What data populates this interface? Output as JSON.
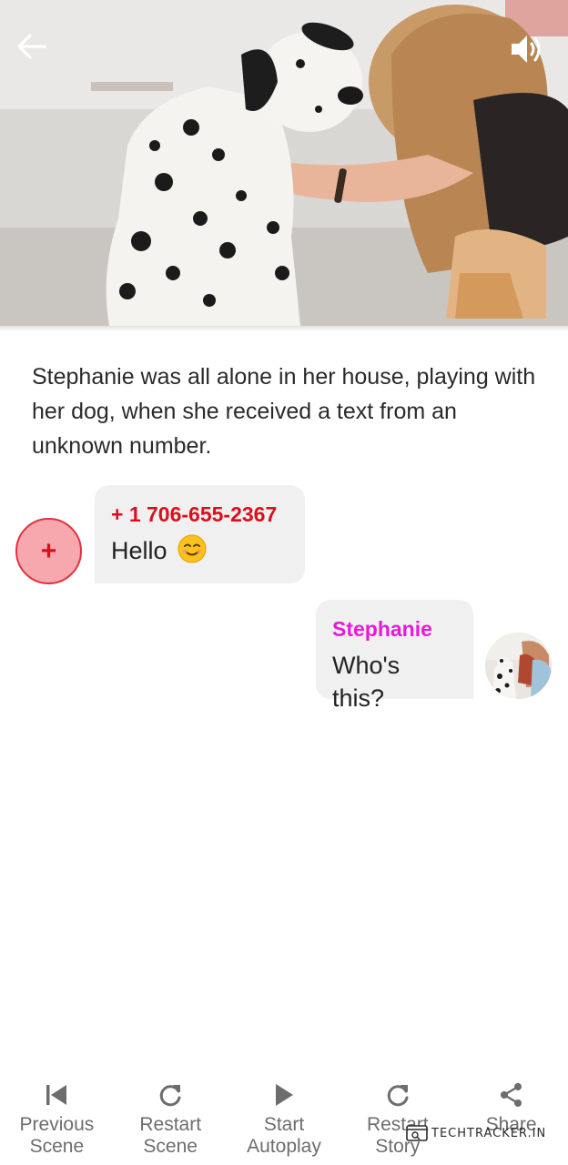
{
  "header": {
    "back_icon": "arrow-left-icon",
    "sound_icon": "volume-up-icon"
  },
  "story": {
    "narration": "Stephanie was all alone in her house, playing with her dog, when she received a text from an unknown number."
  },
  "messages": [
    {
      "sender": "+ 1 706-655-2367",
      "text": "Hello",
      "emoji": "smiling-face-icon",
      "side": "left",
      "sender_color": "#d8101e"
    },
    {
      "sender": "Stephanie",
      "text": "Who's this?",
      "side": "right",
      "sender_color": "#e61ad9"
    }
  ],
  "unknown_avatar": {
    "symbol": "+",
    "fill": "#f7a8ae",
    "border": "#e0313f"
  },
  "toolbar": {
    "items": [
      {
        "label": "Previous\nScene",
        "icon": "skip-previous-icon"
      },
      {
        "label": "Restart\nScene",
        "icon": "refresh-icon"
      },
      {
        "label": "Start\nAutoplay",
        "icon": "play-icon"
      },
      {
        "label": "Restart\nStory",
        "icon": "refresh-icon"
      },
      {
        "label": "Share",
        "icon": "share-icon"
      }
    ]
  },
  "watermark": {
    "text": "TECHTRACKER.IN"
  },
  "colors": {
    "accent_red": "#d8101e",
    "accent_pink": "#e61ad9",
    "bubble_bg": "#f0f0f0",
    "toolbar_text": "#6d6d6d"
  }
}
